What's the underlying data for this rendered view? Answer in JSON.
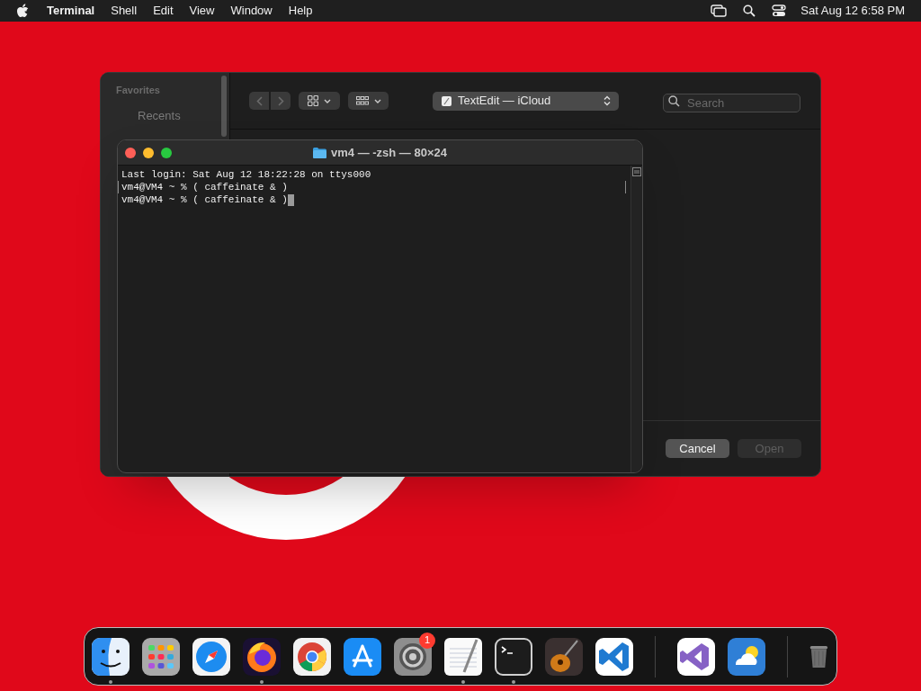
{
  "menu_bar": {
    "app": "Terminal",
    "items": [
      "Shell",
      "Edit",
      "View",
      "Window",
      "Help"
    ],
    "clock": "Sat Aug 12  6:58 PM"
  },
  "open_dialog": {
    "sidebar": {
      "heading": "Favorites",
      "items": [
        "Recents"
      ]
    },
    "location": "TextEdit — iCloud",
    "search": {
      "placeholder": "Search"
    },
    "buttons": [
      {
        "label": "Cancel",
        "disabled": false
      },
      {
        "label": "Open",
        "disabled": true
      }
    ]
  },
  "terminal": {
    "title": "vm4 — -zsh — 80×24",
    "lines": [
      {
        "text": "Last login: Sat Aug 12 18:22:28 on ttys000",
        "marked": false,
        "cursor": false
      },
      {
        "text": "vm4@VM4 ~ % ( caffeinate & )",
        "marked": true,
        "cursor": false
      },
      {
        "text": "vm4@VM4 ~ % ( caffeinate & )",
        "marked": false,
        "cursor": true
      }
    ]
  },
  "dock": {
    "apps": [
      {
        "running": true
      },
      {
        "running": false
      },
      {
        "running": false
      },
      {
        "running": true
      },
      {
        "running": false
      },
      {
        "running": false
      },
      {
        "running": false,
        "badge": "1"
      },
      {
        "running": true
      },
      {
        "running": true
      },
      {
        "running": false
      },
      {
        "running": false
      }
    ],
    "recent": [
      {
        "running": false
      },
      {
        "running": false
      }
    ]
  }
}
